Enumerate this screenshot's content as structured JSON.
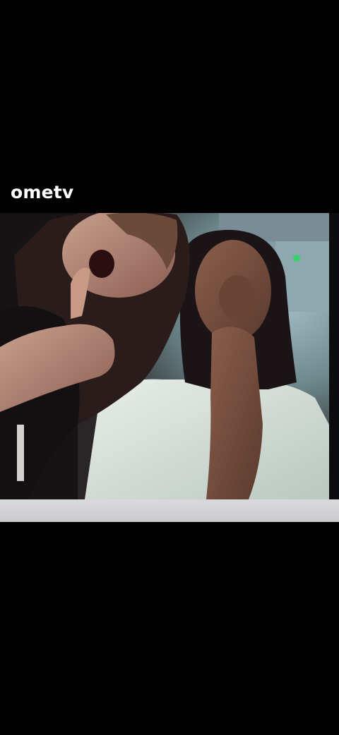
{
  "watermark": {
    "text": "ometv"
  },
  "video": {
    "content": "selfie-video-frame"
  },
  "colors": {
    "background": "#000000",
    "watermark_text": "#ffffff",
    "bottom_strip": "#d0d1d3"
  }
}
